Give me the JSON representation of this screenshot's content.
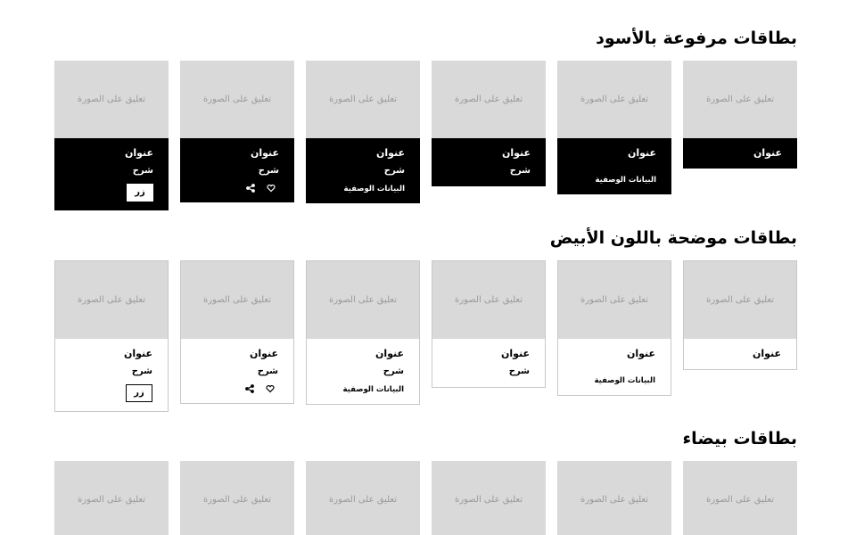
{
  "sections": [
    {
      "title": "بطاقات مرفوعة بالأسود",
      "cards": [
        {
          "caption": "تعليق على الصورة",
          "title": "عنوان"
        },
        {
          "caption": "تعليق على الصورة",
          "title": "عنوان",
          "meta": "البيانات الوصفية"
        },
        {
          "caption": "تعليق على الصورة",
          "title": "عنوان",
          "desc": "شرح"
        },
        {
          "caption": "تعليق على الصورة",
          "title": "عنوان",
          "desc": "شرح",
          "meta": "البيانات الوصفية"
        },
        {
          "caption": "تعليق على الصورة",
          "title": "عنوان",
          "desc": "شرح",
          "actions": [
            "heart-icon",
            "share-icon"
          ]
        },
        {
          "caption": "تعليق على الصورة",
          "title": "عنوان",
          "desc": "شرح",
          "button": "زر"
        }
      ]
    },
    {
      "title": "بطاقات موضحة باللون الأبيض",
      "cards": [
        {
          "caption": "تعليق على الصورة",
          "title": "عنوان"
        },
        {
          "caption": "تعليق على الصورة",
          "title": "عنوان",
          "meta": "البيانات الوصفية"
        },
        {
          "caption": "تعليق على الصورة",
          "title": "عنوان",
          "desc": "شرح"
        },
        {
          "caption": "تعليق على الصورة",
          "title": "عنوان",
          "desc": "شرح",
          "meta": "البيانات الوصفية"
        },
        {
          "caption": "تعليق على الصورة",
          "title": "عنوان",
          "desc": "شرح",
          "actions": [
            "heart-icon",
            "share-icon"
          ]
        },
        {
          "caption": "تعليق على الصورة",
          "title": "عنوان",
          "desc": "شرح",
          "button": "زر"
        }
      ]
    },
    {
      "title": "بطاقات بيضاء",
      "cards": [
        {
          "caption": "تعليق على الصورة"
        },
        {
          "caption": "تعليق على الصورة"
        },
        {
          "caption": "تعليق على الصورة"
        },
        {
          "caption": "تعليق على الصورة"
        },
        {
          "caption": "تعليق على الصورة"
        },
        {
          "caption": "تعليق على الصورة"
        }
      ]
    }
  ]
}
